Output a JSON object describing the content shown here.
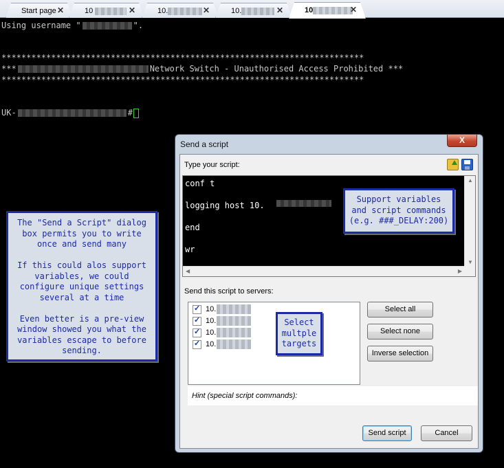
{
  "tabs": [
    {
      "label": "Start page",
      "active": false,
      "close_icon": "close-icon"
    },
    {
      "label": "10",
      "active": false,
      "close_icon": "close-icon"
    },
    {
      "label": "10.",
      "active": false,
      "close_icon": "close-icon"
    },
    {
      "label": "10.",
      "active": false,
      "close_icon": "close-icon"
    },
    {
      "label": "10",
      "active": true,
      "close_icon": "close-icon"
    }
  ],
  "terminal": {
    "line1_prefix": "Using username \"",
    "line1_suffix": "\".",
    "stars": "*************************************************************************",
    "banner_prefix": "***",
    "banner_text": "Network Switch - Unauthorised Access Prohibited ***",
    "prompt_prefix": "UK-",
    "prompt_suffix": "#"
  },
  "note_left": {
    "p1": "The \"Send a Script\" dialog box permits you to write once and send many",
    "p2": "If this could alos support variables, we could configure unique settings several at a time",
    "p3": "Even better is a pre-view window showed you what the variables escape to before sending."
  },
  "note_vars": {
    "text": "Support variables and script commands (e.g. ###_DELAY:200)"
  },
  "note_targets": {
    "text": "Select multple targets"
  },
  "dialog": {
    "title": "Send a script",
    "close_label": "X",
    "type_label": "Type your script:",
    "script": "conf t\n\nlogging host 10.\n\nend\n\nwr",
    "servers_label": "Send this script to servers:",
    "servers": [
      "10.",
      "10.",
      "10.",
      "10."
    ],
    "select_all": "Select all",
    "select_none": "Select none",
    "inverse_selection": "Inverse selection",
    "hint": "Hint (special script commands):",
    "send_button": "Send script",
    "cancel_button": "Cancel",
    "icons": [
      "open-script-icon",
      "save-script-icon"
    ]
  }
}
